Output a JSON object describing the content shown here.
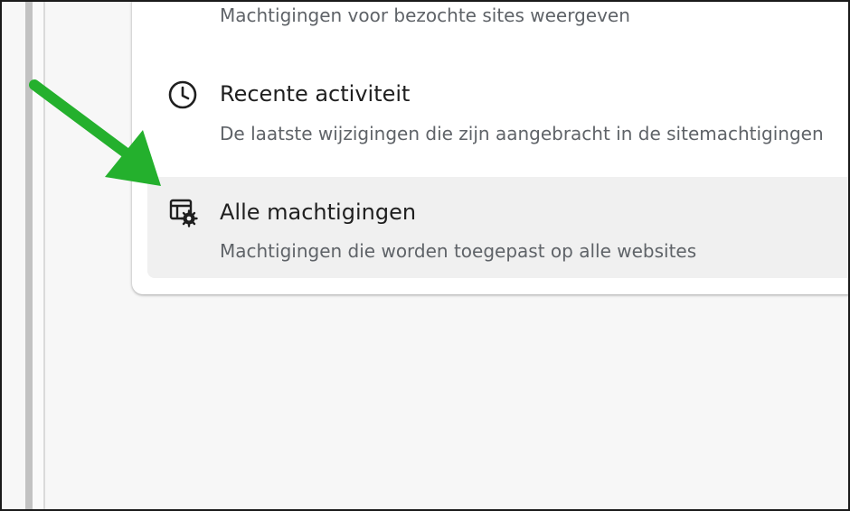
{
  "settings": {
    "rows": [
      {
        "title": "",
        "subtitle": "Machtigingen voor bezochte sites weergeven",
        "icon": "none"
      },
      {
        "title": "Recente activiteit",
        "subtitle": "De laatste wijzigingen die zijn aangebracht in de sitemachtigingen",
        "icon": "clock-icon"
      },
      {
        "title": "Alle machtigingen",
        "subtitle": "Machtigingen die worden toegepast op alle websites",
        "icon": "site-settings-icon"
      }
    ]
  },
  "colors": {
    "arrow": "#24b02d",
    "highlight_row": "#f0f0f0",
    "title_text": "#1f1f1f",
    "subtitle_text": "#5f6368"
  }
}
